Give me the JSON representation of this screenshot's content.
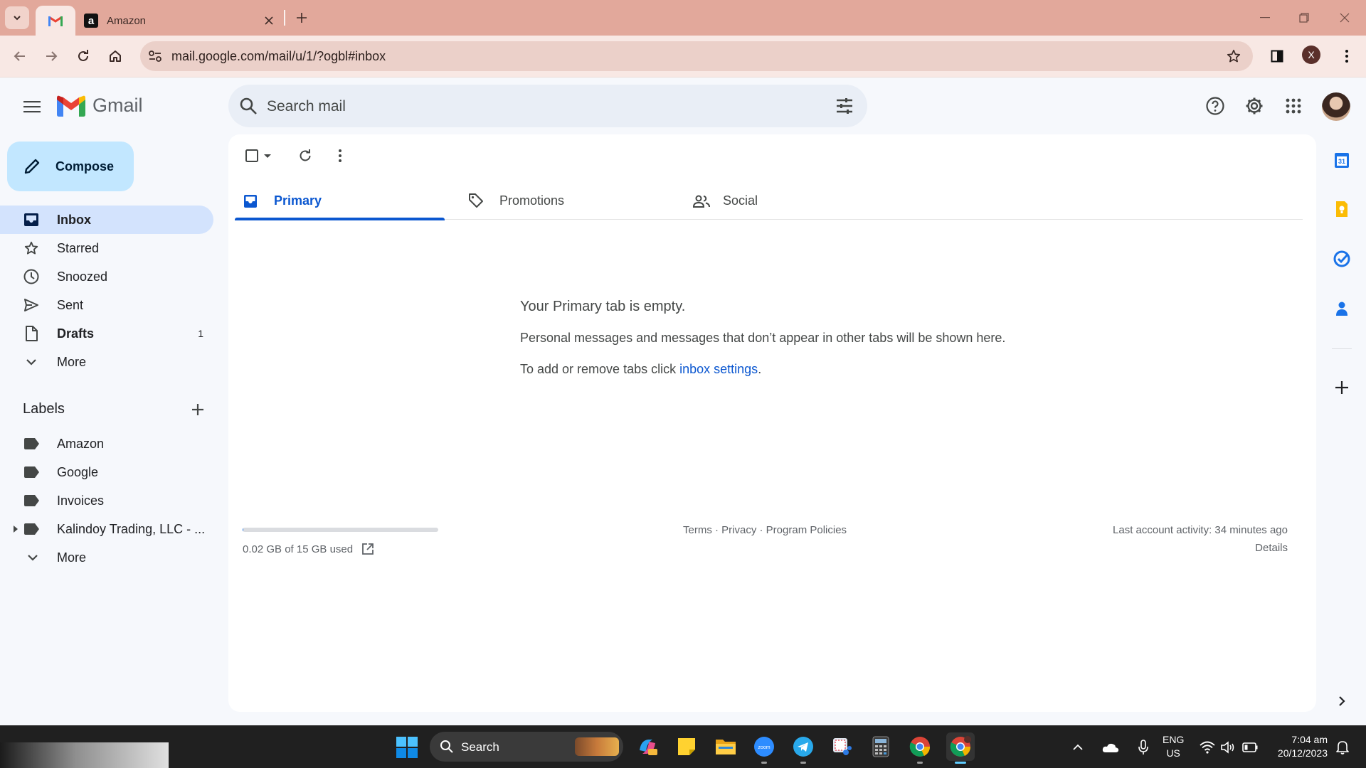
{
  "browser": {
    "tabs": [
      {
        "title": "",
        "favicon": "gmail-icon",
        "active": true
      },
      {
        "title": "Amazon",
        "favicon": "amazon-icon",
        "active": false
      }
    ],
    "url": "mail.google.com/mail/u/1/?ogbl#inbox",
    "profile_initial": "X"
  },
  "gmail": {
    "logo_text": "Gmail",
    "search_placeholder": "Search mail",
    "compose_label": "Compose",
    "nav": [
      {
        "label": "Inbox",
        "icon": "inbox-icon",
        "count": ""
      },
      {
        "label": "Starred",
        "icon": "star-icon",
        "count": ""
      },
      {
        "label": "Snoozed",
        "icon": "clock-icon",
        "count": ""
      },
      {
        "label": "Sent",
        "icon": "send-icon",
        "count": ""
      },
      {
        "label": "Drafts",
        "icon": "draft-icon",
        "count": "1"
      },
      {
        "label": "More",
        "icon": "chevron-down-icon",
        "count": ""
      }
    ],
    "labels_heading": "Labels",
    "labels": [
      {
        "label": "Amazon"
      },
      {
        "label": "Google"
      },
      {
        "label": "Invoices"
      },
      {
        "label": "Kalindoy Trading, LLC - ..."
      },
      {
        "label": "More"
      }
    ],
    "tabs": [
      {
        "label": "Primary",
        "icon": "inbox-tab-icon",
        "active": true
      },
      {
        "label": "Promotions",
        "icon": "tag-icon",
        "active": false
      },
      {
        "label": "Social",
        "icon": "people-icon",
        "active": false
      }
    ],
    "empty": {
      "title": "Your Primary tab is empty.",
      "message": "Personal messages and messages that don’t appear in other tabs will be shown here.",
      "hint_prefix": "To add or remove tabs click ",
      "hint_link": "inbox settings",
      "hint_suffix": "."
    },
    "footer": {
      "storage_text": "0.02 GB of 15 GB used",
      "storage_fraction": 0.0013,
      "links": "Terms · Privacy · Program Policies",
      "last_activity": "Last account activity: 34 minutes ago",
      "details": "Details"
    },
    "side_panel": [
      "calendar-icon",
      "keep-icon",
      "tasks-icon",
      "contacts-icon",
      "add-icon",
      "chevron-right-icon"
    ]
  },
  "taskbar": {
    "search_label": "Search",
    "apps": [
      "copilot-icon",
      "sticky-notes-icon",
      "file-explorer-icon",
      "zoom-icon",
      "telegram-icon",
      "snipping-tool-icon",
      "calculator-icon",
      "chrome-icon",
      "chrome-profile-icon"
    ],
    "lang_line1": "ENG",
    "lang_line2": "US",
    "time": "7:04 am",
    "date": "20/12/2023"
  },
  "colors": {
    "accent": "#0b57d0",
    "compose_bg": "#c2e7ff",
    "active_nav_bg": "#d3e3fd",
    "chrome_frame": "#e2a89b"
  }
}
